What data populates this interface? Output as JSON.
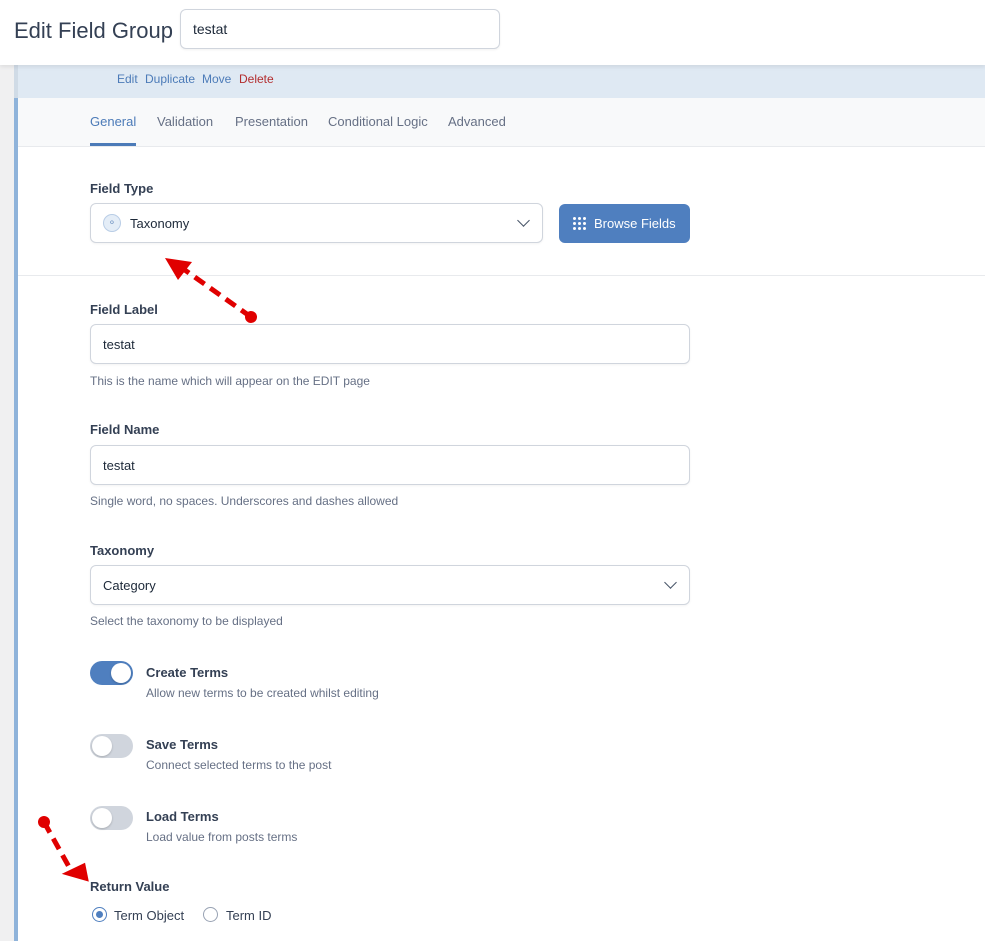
{
  "header": {
    "title": "Edit Field Group",
    "group_title_value": "testat"
  },
  "actions": {
    "edit": "Edit",
    "duplicate": "Duplicate",
    "move": "Move",
    "delete": "Delete"
  },
  "tabs": [
    {
      "label": "General",
      "active": true
    },
    {
      "label": "Validation"
    },
    {
      "label": "Presentation"
    },
    {
      "label": "Conditional Logic"
    },
    {
      "label": "Advanced"
    }
  ],
  "field_type": {
    "label": "Field Type",
    "value": "Taxonomy",
    "browse_label": "Browse Fields"
  },
  "field_label": {
    "label": "Field Label",
    "value": "testat",
    "help": "This is the name which will appear on the EDIT page"
  },
  "field_name": {
    "label": "Field Name",
    "value": "testat",
    "help": "Single word, no spaces. Underscores and dashes allowed"
  },
  "taxonomy": {
    "label": "Taxonomy",
    "value": "Category",
    "help": "Select the taxonomy to be displayed"
  },
  "toggles": [
    {
      "label": "Create Terms",
      "help": "Allow new terms to be created whilst editing",
      "on": true
    },
    {
      "label": "Save Terms",
      "help": "Connect selected terms to the post",
      "on": false
    },
    {
      "label": "Load Terms",
      "help": "Load value from posts terms",
      "on": false
    }
  ],
  "return_value": {
    "label": "Return Value",
    "options": [
      "Term Object",
      "Term ID"
    ],
    "selected": "Term Object"
  },
  "colors": {
    "accent": "#4f7fbf",
    "annotation": "#e00000",
    "delete": "#b32d2e"
  }
}
